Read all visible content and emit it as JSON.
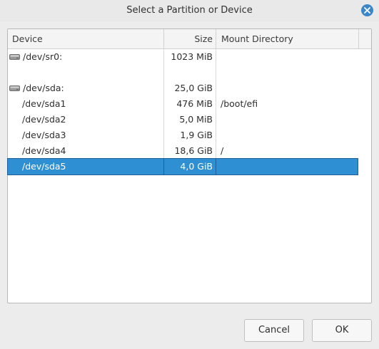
{
  "window": {
    "title": "Select a Partition or Device",
    "close_icon": "close-icon"
  },
  "table": {
    "columns": {
      "device": "Device",
      "size": "Size",
      "mount": "Mount Directory"
    },
    "rows": [
      {
        "device": "/dev/sr0:",
        "size": "1023 MiB",
        "mount": "",
        "type": "disk",
        "icon": "drive-icon"
      },
      {
        "device": "/dev/sda:",
        "size": "25,0 GiB",
        "mount": "",
        "type": "disk",
        "icon": "drive-icon"
      },
      {
        "device": "/dev/sda1",
        "size": "476 MiB",
        "mount": "/boot/efi",
        "type": "partition"
      },
      {
        "device": "/dev/sda2",
        "size": "5,0 MiB",
        "mount": "",
        "type": "partition"
      },
      {
        "device": "/dev/sda3",
        "size": "1,9 GiB",
        "mount": "",
        "type": "partition"
      },
      {
        "device": "/dev/sda4",
        "size": "18,6 GiB",
        "mount": "/",
        "type": "partition"
      },
      {
        "device": "/dev/sda5",
        "size": "4,0 GiB",
        "mount": "",
        "type": "partition",
        "selected": true
      }
    ]
  },
  "buttons": {
    "cancel": "Cancel",
    "ok": "OK"
  },
  "colors": {
    "selection": "#2f8fd3",
    "close_button": "#3a86c8"
  }
}
